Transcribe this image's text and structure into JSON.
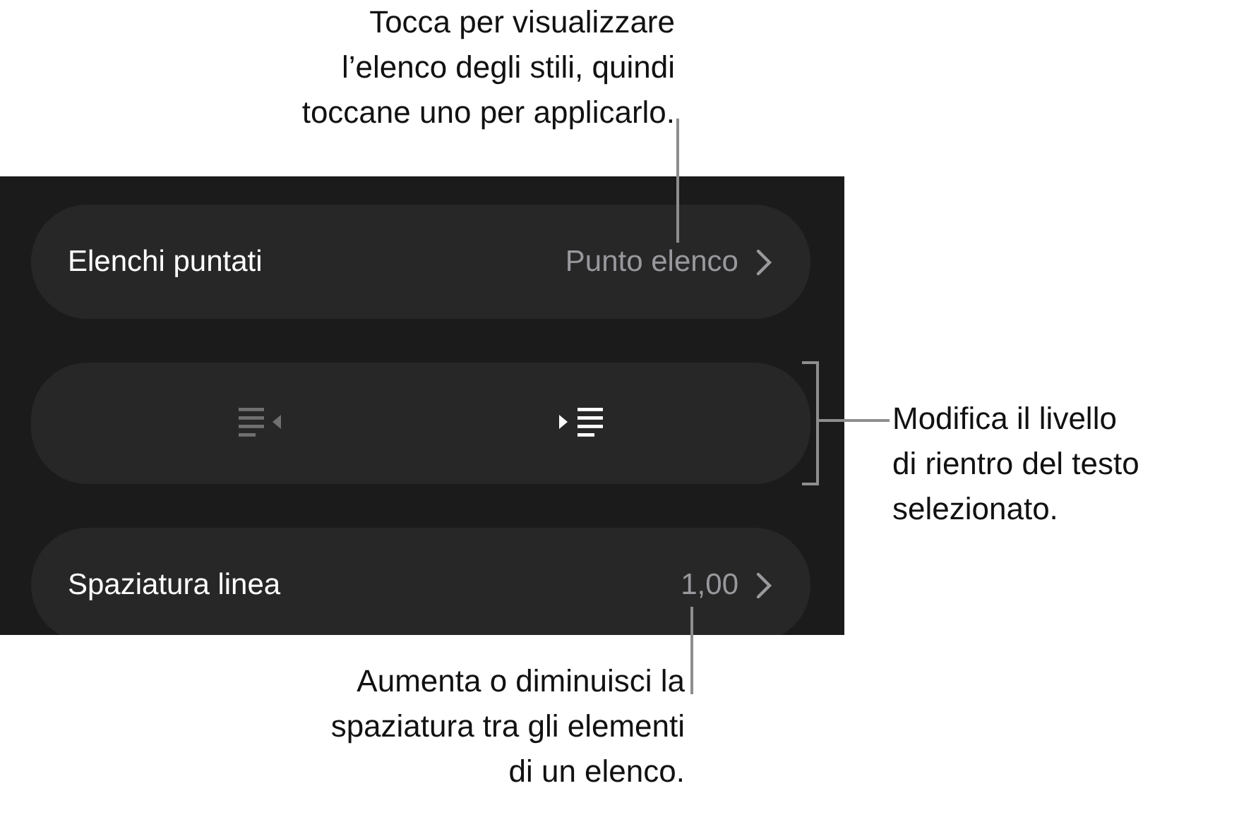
{
  "callouts": {
    "top": [
      "Tocca per visualizzare",
      "l’elenco degli stili, quindi",
      "toccane uno per applicarlo."
    ],
    "right": [
      "Modifica il livello",
      "di rientro del testo",
      "selezionato."
    ],
    "bottom": [
      "Aumenta o diminuisci la",
      "spaziatura tra gli elementi",
      "di un elenco."
    ]
  },
  "rows": [
    {
      "kind": "value",
      "label": "Elenchi puntati",
      "value": "Punto elenco"
    },
    {
      "kind": "indent",
      "buttons": [
        {
          "kind": "outdent",
          "disabled": true
        },
        {
          "kind": "indent",
          "disabled": false
        }
      ]
    },
    {
      "kind": "value",
      "label": "Spaziatura linea",
      "value": "1,00"
    }
  ]
}
